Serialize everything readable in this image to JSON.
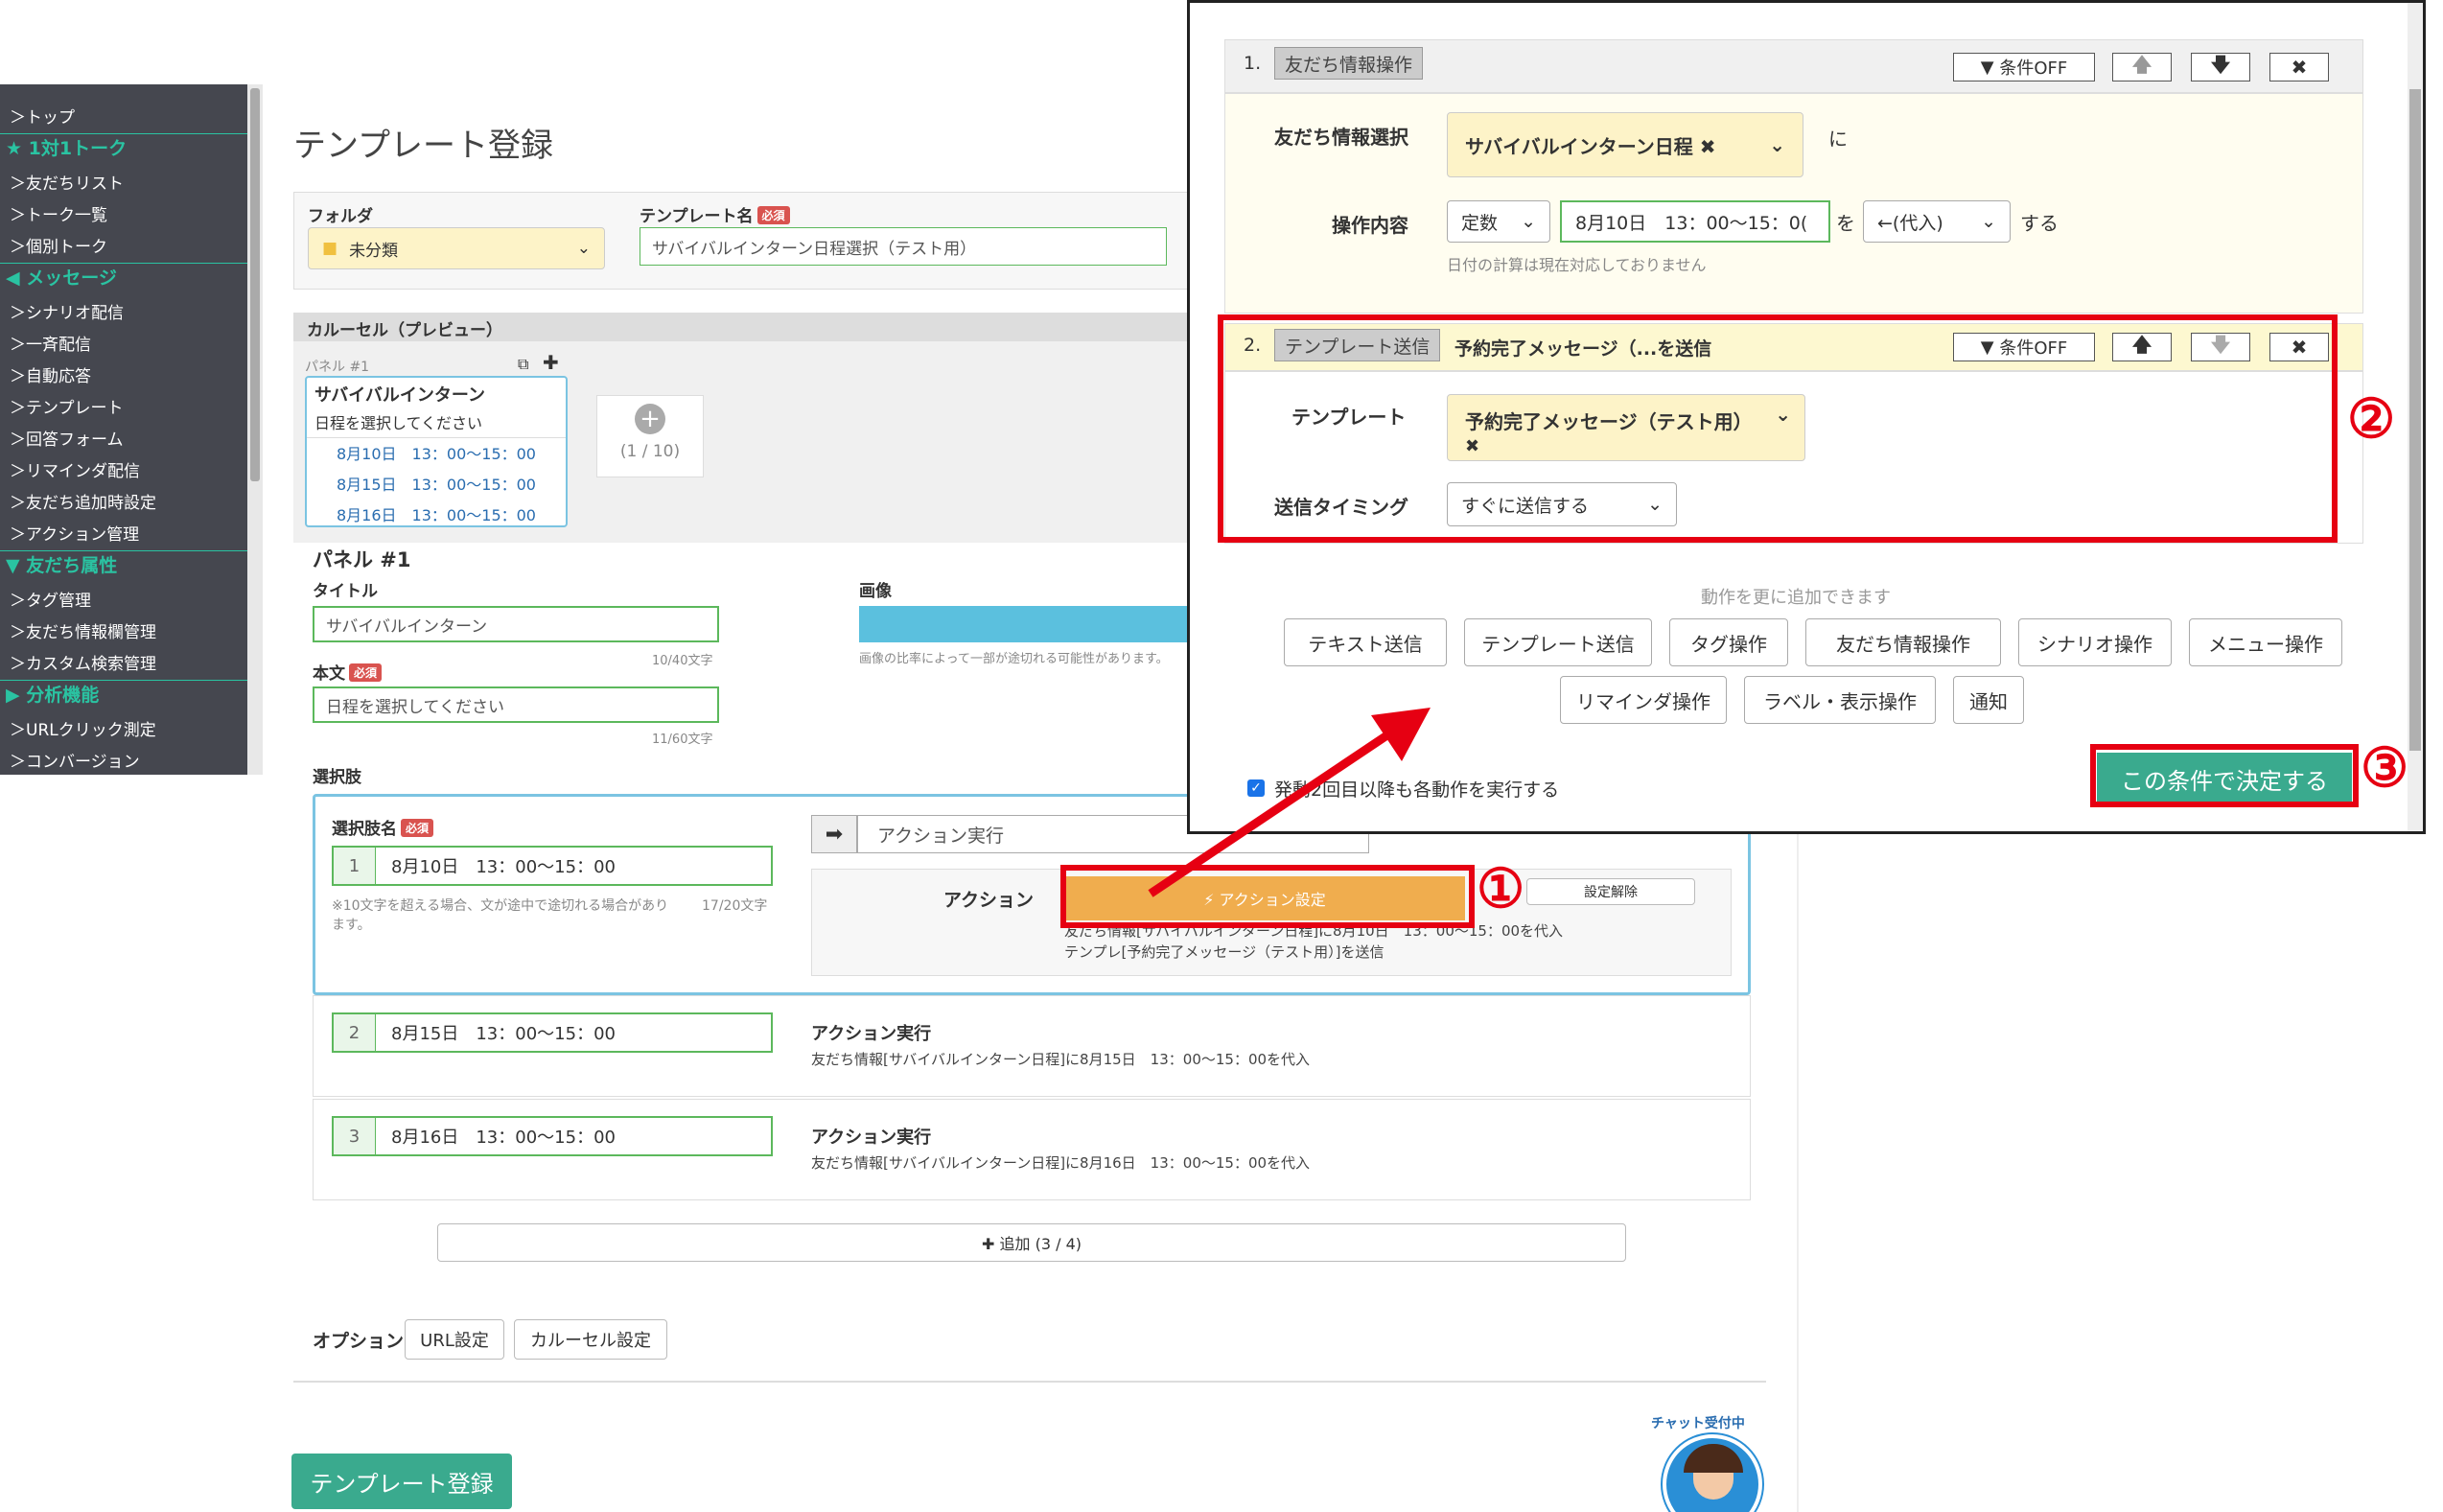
{
  "sidebar": {
    "items": [
      {
        "label": "＞トップ",
        "type": "item"
      },
      {
        "label": "★ 1対1トーク",
        "type": "section"
      },
      {
        "label": "＞友だちリスト",
        "type": "item"
      },
      {
        "label": "＞トーク一覧",
        "type": "item"
      },
      {
        "label": "＞個別トーク",
        "type": "item"
      },
      {
        "label": "◀ メッセージ",
        "type": "section"
      },
      {
        "label": "＞シナリオ配信",
        "type": "item"
      },
      {
        "label": "＞一斉配信",
        "type": "item"
      },
      {
        "label": "＞自動応答",
        "type": "item"
      },
      {
        "label": "＞テンプレート",
        "type": "item"
      },
      {
        "label": "＞回答フォーム",
        "type": "item"
      },
      {
        "label": "＞リマインダ配信",
        "type": "item"
      },
      {
        "label": "＞友だち追加時設定",
        "type": "item"
      },
      {
        "label": "＞アクション管理",
        "type": "item"
      },
      {
        "label": "▼ 友だち属性",
        "type": "section"
      },
      {
        "label": "＞タグ管理",
        "type": "item"
      },
      {
        "label": "＞友だち情報欄管理",
        "type": "item"
      },
      {
        "label": "＞カスタム検索管理",
        "type": "item"
      },
      {
        "label": "▶ 分析機能",
        "type": "section"
      },
      {
        "label": "＞URLクリック測定",
        "type": "item"
      },
      {
        "label": "＞コンバージョン",
        "type": "item"
      }
    ]
  },
  "main": {
    "page_title": "テンプレート登録",
    "folder_label": "フォルダ",
    "folder_value": "未分類",
    "template_name_label": "テンプレート名",
    "required": "必須",
    "template_name_value": "サバイバルインターン日程選択（テスト用）",
    "carousel_header": "カルーセル（プレビュー）",
    "preview": {
      "panel_tag": "パネル #1",
      "title": "サバイバルインターン",
      "body": "日程を選択してください",
      "options": [
        "8月10日　13：00〜15：00",
        "8月15日　13：00〜15：00",
        "8月16日　13：00〜15：00"
      ],
      "counter": "(1 / 10)"
    },
    "panel_heading": "パネル #1",
    "title_label": "タイトル",
    "title_value": "サバイバルインターン",
    "title_count": "10/40文字",
    "image_label": "画像",
    "image_note": "画像の比率によって一部が途切れる可能性があります。",
    "body_label": "本文",
    "body_value": "日程を選択してください",
    "body_count": "11/60文字",
    "choices_label": "選択肢",
    "choice_name_label": "選択肢名",
    "choice_note": "※10文字を超える場合、文が途中で途切れる場合があります。",
    "choice_count": "17/20文字",
    "action_select": "アクション実行",
    "action_label": "アクション",
    "action_setting_btn": "⚡ アクション設定",
    "action_clear_btn": "設定解除",
    "action_desc_1": "友だち情報[サバイバルインターン日程]に8月10日　13：00〜15：00を代入",
    "action_desc_2": "テンプレ[予約完了メッセージ（テスト用）]を送信",
    "choices": [
      {
        "num": "1",
        "value": "8月10日　13：00〜15：00"
      },
      {
        "num": "2",
        "value": "8月15日　13：00〜15：00",
        "action_title": "アクション実行",
        "action_desc": "友だち情報[サバイバルインターン日程]に8月15日　13：00〜15：00を代入"
      },
      {
        "num": "3",
        "value": "8月16日　13：00〜15：00",
        "action_title": "アクション実行",
        "action_desc": "友だち情報[サバイバルインターン日程]に8月16日　13：00〜15：00を代入"
      }
    ],
    "add_choice": "✚ 追加 (3 / 4)",
    "option_label": "オプション",
    "url_setting": "URL設定",
    "carousel_setting": "カルーセル設定",
    "register_button": "テンプレート登録",
    "chat_badge": "チャット受付中"
  },
  "popup": {
    "step1": {
      "index": "1.",
      "tag": "友だち情報操作",
      "cond_off": "条件OFF",
      "field_label": "友だち情報選択",
      "field_value": "サバイバルインターン日程 ✖",
      "ni": "に",
      "op_label": "操作内容",
      "op_type": "定数",
      "op_value": "8月10日　13：00〜15：0(",
      "wo": "を",
      "op_mode": "←(代入)",
      "suru": "する",
      "date_note": "日付の計算は現在対応しておりません"
    },
    "step2": {
      "index": "2.",
      "tag": "テンプレート送信",
      "title": "予約完了メッセージ（...を送信",
      "cond_off": "条件OFF",
      "template_label": "テンプレート",
      "template_value": "予約完了メッセージ（テスト用）",
      "template_x": "✖",
      "timing_label": "送信タイミング",
      "timing_value": "すぐに送信する"
    },
    "add_note": "動作を更に追加できます",
    "add_buttons_row1": [
      "テキスト送信",
      "テンプレート送信",
      "タグ操作",
      "友だち情報操作",
      "シナリオ操作",
      "メニュー操作"
    ],
    "add_buttons_row2": [
      "リマインダ操作",
      "ラベル・表示操作",
      "通知"
    ],
    "checkbox_label": "発動2回目以降も各動作を実行する",
    "decide_button": "この条件で決定する"
  },
  "annotations": {
    "one": "①",
    "two": "②",
    "three": "③"
  },
  "colors": {
    "accent": "#2ac3a2",
    "red": "#e60012",
    "orange": "#f0ad4e",
    "green": "#5cb85c",
    "sidebar": "#45474f",
    "highlight": "#fdf8d0"
  }
}
